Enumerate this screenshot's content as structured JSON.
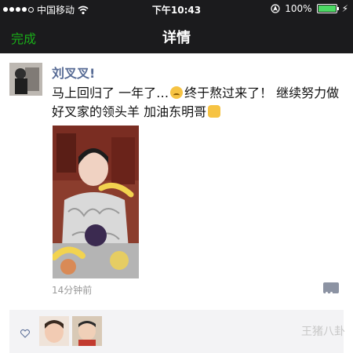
{
  "status_bar": {
    "carrier": "中国移动",
    "time": "下午10:43",
    "battery": "100%"
  },
  "nav": {
    "back_label": "完成",
    "title": "详情"
  },
  "post": {
    "author": "刘叉叉!",
    "text_part1": "马上回归了 一年了…",
    "text_part2": "终于熬过来了！ 继续努力做好叉家的领头羊 加油东明哥",
    "timestamp": "14分钟前"
  },
  "likes": {
    "count_avatars": 2
  },
  "watermark": {
    "text": "王猪八卦"
  }
}
